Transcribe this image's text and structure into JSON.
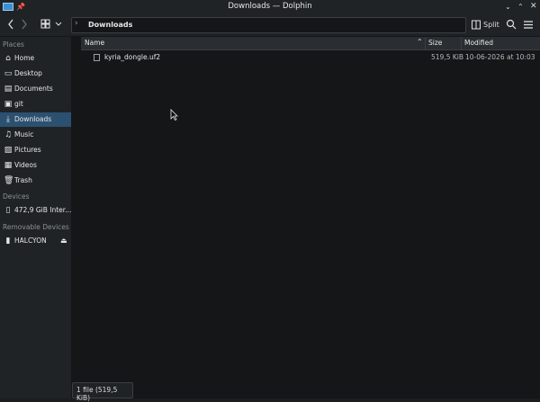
{
  "window": {
    "title": "Downloads — Dolphin"
  },
  "toolbar": {
    "back_icon": "chevron-left-icon",
    "split_label": "Split",
    "view_icon": "view-mode-icon"
  },
  "breadcrumb": {
    "current": "Downloads"
  },
  "sidebar": {
    "places_header": "Places",
    "places": [
      {
        "label": "Home",
        "icon": "home-icon"
      },
      {
        "label": "Desktop",
        "icon": "desktop-icon"
      },
      {
        "label": "Documents",
        "icon": "documents-icon"
      },
      {
        "label": "git",
        "icon": "folder-icon"
      },
      {
        "label": "Downloads",
        "icon": "download-icon",
        "active": true
      },
      {
        "label": "Music",
        "icon": "music-icon"
      },
      {
        "label": "Pictures",
        "icon": "pictures-icon"
      },
      {
        "label": "Videos",
        "icon": "videos-icon"
      },
      {
        "label": "Trash",
        "icon": "trash-icon"
      }
    ],
    "devices_header": "Devices",
    "devices": [
      {
        "label": "472,9 GiB Inter...",
        "icon": "drive-icon"
      }
    ],
    "removable_header": "Removable Devices",
    "removable": [
      {
        "label": "HALCYON",
        "icon": "usb-icon"
      }
    ]
  },
  "columns": {
    "name": "Name",
    "size": "Size",
    "modified": "Modified"
  },
  "files": [
    {
      "name": "kyria_dongle.uf2",
      "size": "519,5 KiB",
      "modified": "10-06-2026 at 10:03"
    }
  ],
  "status": {
    "text": "1 file (519,5 KiB)"
  }
}
